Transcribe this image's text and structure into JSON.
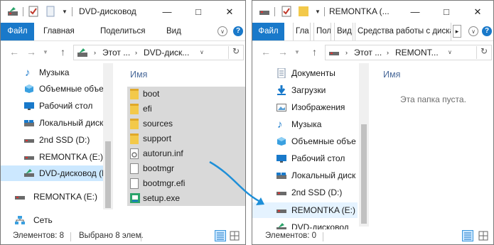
{
  "left": {
    "title": "DVD-дисковод",
    "ribbon_tabs": [
      "Файл",
      "Главная",
      "Поделиться",
      "Вид"
    ],
    "breadcrumb": [
      "Этот ...",
      "DVD-диск..."
    ],
    "nav_items": [
      "Музыка",
      "Объемные объе",
      "Рабочий стол",
      "Локальный диск",
      "2nd SSD (D:)",
      "REMONTKA (E:)",
      "DVD-дисковод (F",
      "REMONTKA (E:)",
      "Сеть"
    ],
    "column_header": "Имя",
    "files": [
      "boot",
      "efi",
      "sources",
      "support",
      "autorun.inf",
      "bootmgr",
      "bootmgr.efi",
      "setup.exe"
    ],
    "status_count": "Элементов: 8",
    "status_selected": "Выбрано 8 элем."
  },
  "right": {
    "title": "REMONTKA (...",
    "ribbon_tabs": [
      "Файл",
      "Гла",
      "Пол",
      "Вид",
      "Средства работы с диска"
    ],
    "breadcrumb": [
      "Этот ...",
      "REMONT..."
    ],
    "nav_items": [
      "Документы",
      "Загрузки",
      "Изображения",
      "Музыка",
      "Объемные объе",
      "Рабочий стол",
      "Локальный диск",
      "2nd SSD (D:)",
      "REMONTKA (E:)",
      "DVD-дисковод"
    ],
    "column_header": "Имя",
    "empty_text": "Эта папка пуста.",
    "status_count": "Элементов: 0"
  },
  "colors": {
    "accent": "#1979ca",
    "selection": "#cce8ff",
    "drag_arrow": "#1e8fd8",
    "folder": "#f3c94a"
  }
}
